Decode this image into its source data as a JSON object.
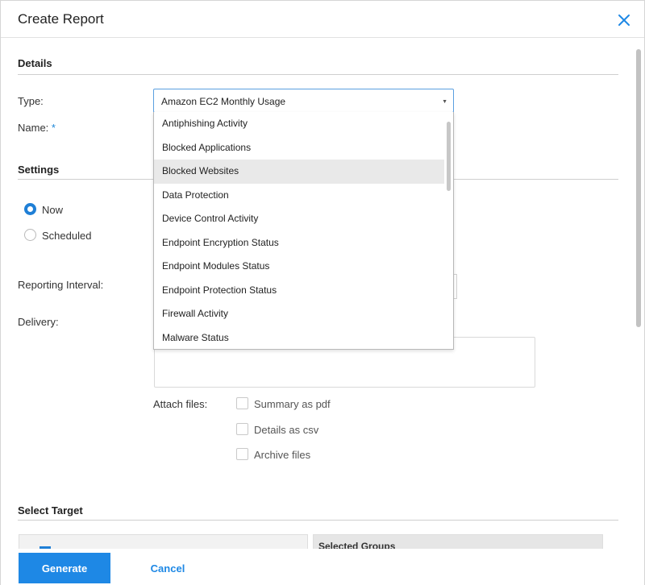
{
  "dialog": {
    "title": "Create Report",
    "close_icon": "close-icon"
  },
  "details": {
    "section_title": "Details",
    "type_label": "Type:",
    "type_value": "Amazon EC2 Monthly Usage",
    "name_label": "Name:",
    "name_required_mark": "*",
    "type_options": [
      "Antiphishing Activity",
      "Blocked Applications",
      "Blocked Websites",
      "Data Protection",
      "Device Control Activity",
      "Endpoint Encryption Status",
      "Endpoint Modules Status",
      "Endpoint Protection Status",
      "Firewall Activity",
      "Malware Status"
    ],
    "highlighted_option": "Blocked Websites"
  },
  "settings": {
    "section_title": "Settings",
    "radio_now": "Now",
    "radio_scheduled": "Scheduled",
    "selected_radio": "Now",
    "reporting_interval_label": "Reporting Interval:",
    "delivery_label": "Delivery:",
    "attach_files_label": "Attach files:",
    "attachments": [
      {
        "label": "Summary as pdf",
        "checked": false
      },
      {
        "label": "Details as csv",
        "checked": false
      },
      {
        "label": "Archive files",
        "checked": false
      }
    ]
  },
  "target": {
    "section_title": "Select Target",
    "selected_groups_title": "Selected Groups"
  },
  "footer": {
    "generate_label": "Generate",
    "cancel_label": "Cancel"
  },
  "colors": {
    "accent": "#1e88e5",
    "highlight": "#e9e9e9"
  }
}
